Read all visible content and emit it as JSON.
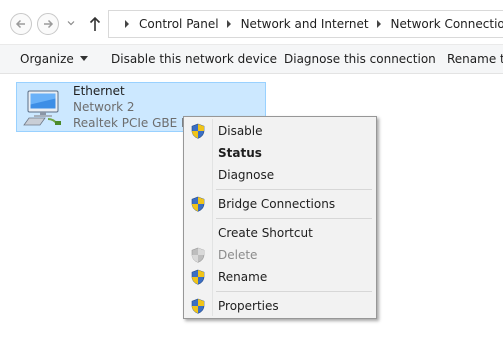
{
  "nav": {
    "back_icon": "back-arrow-icon",
    "forward_icon": "forward-arrow-icon",
    "up_icon": "up-arrow-icon"
  },
  "breadcrumb": [
    "Control Panel",
    "Network and Internet",
    "Network Connections"
  ],
  "toolbar": {
    "organize": "Organize",
    "disable": "Disable this network device",
    "diagnose": "Diagnose this connection",
    "rename": "Rename th"
  },
  "adapter": {
    "name": "Ethernet",
    "network": "Network  2",
    "device": "Realtek PCIe GBE Family Controller"
  },
  "context_menu": {
    "items": [
      {
        "label": "Disable",
        "shield": true,
        "bold": false,
        "disabled": false
      },
      {
        "label": "Status",
        "shield": false,
        "bold": true,
        "disabled": false
      },
      {
        "label": "Diagnose",
        "shield": false,
        "bold": false,
        "disabled": false
      },
      {
        "label": "Bridge Connections",
        "shield": true,
        "bold": false,
        "disabled": false
      },
      {
        "label": "Create Shortcut",
        "shield": false,
        "bold": false,
        "disabled": false
      },
      {
        "label": "Delete",
        "shield": true,
        "bold": false,
        "disabled": true
      },
      {
        "label": "Rename",
        "shield": true,
        "bold": false,
        "disabled": false
      },
      {
        "label": "Properties",
        "shield": true,
        "bold": false,
        "disabled": false
      }
    ]
  },
  "colors": {
    "selection_fill": "#cce8ff",
    "selection_border": "#99d1ff",
    "menu_bg": "#f2f2f2",
    "disabled_text": "#8b8b8b"
  }
}
